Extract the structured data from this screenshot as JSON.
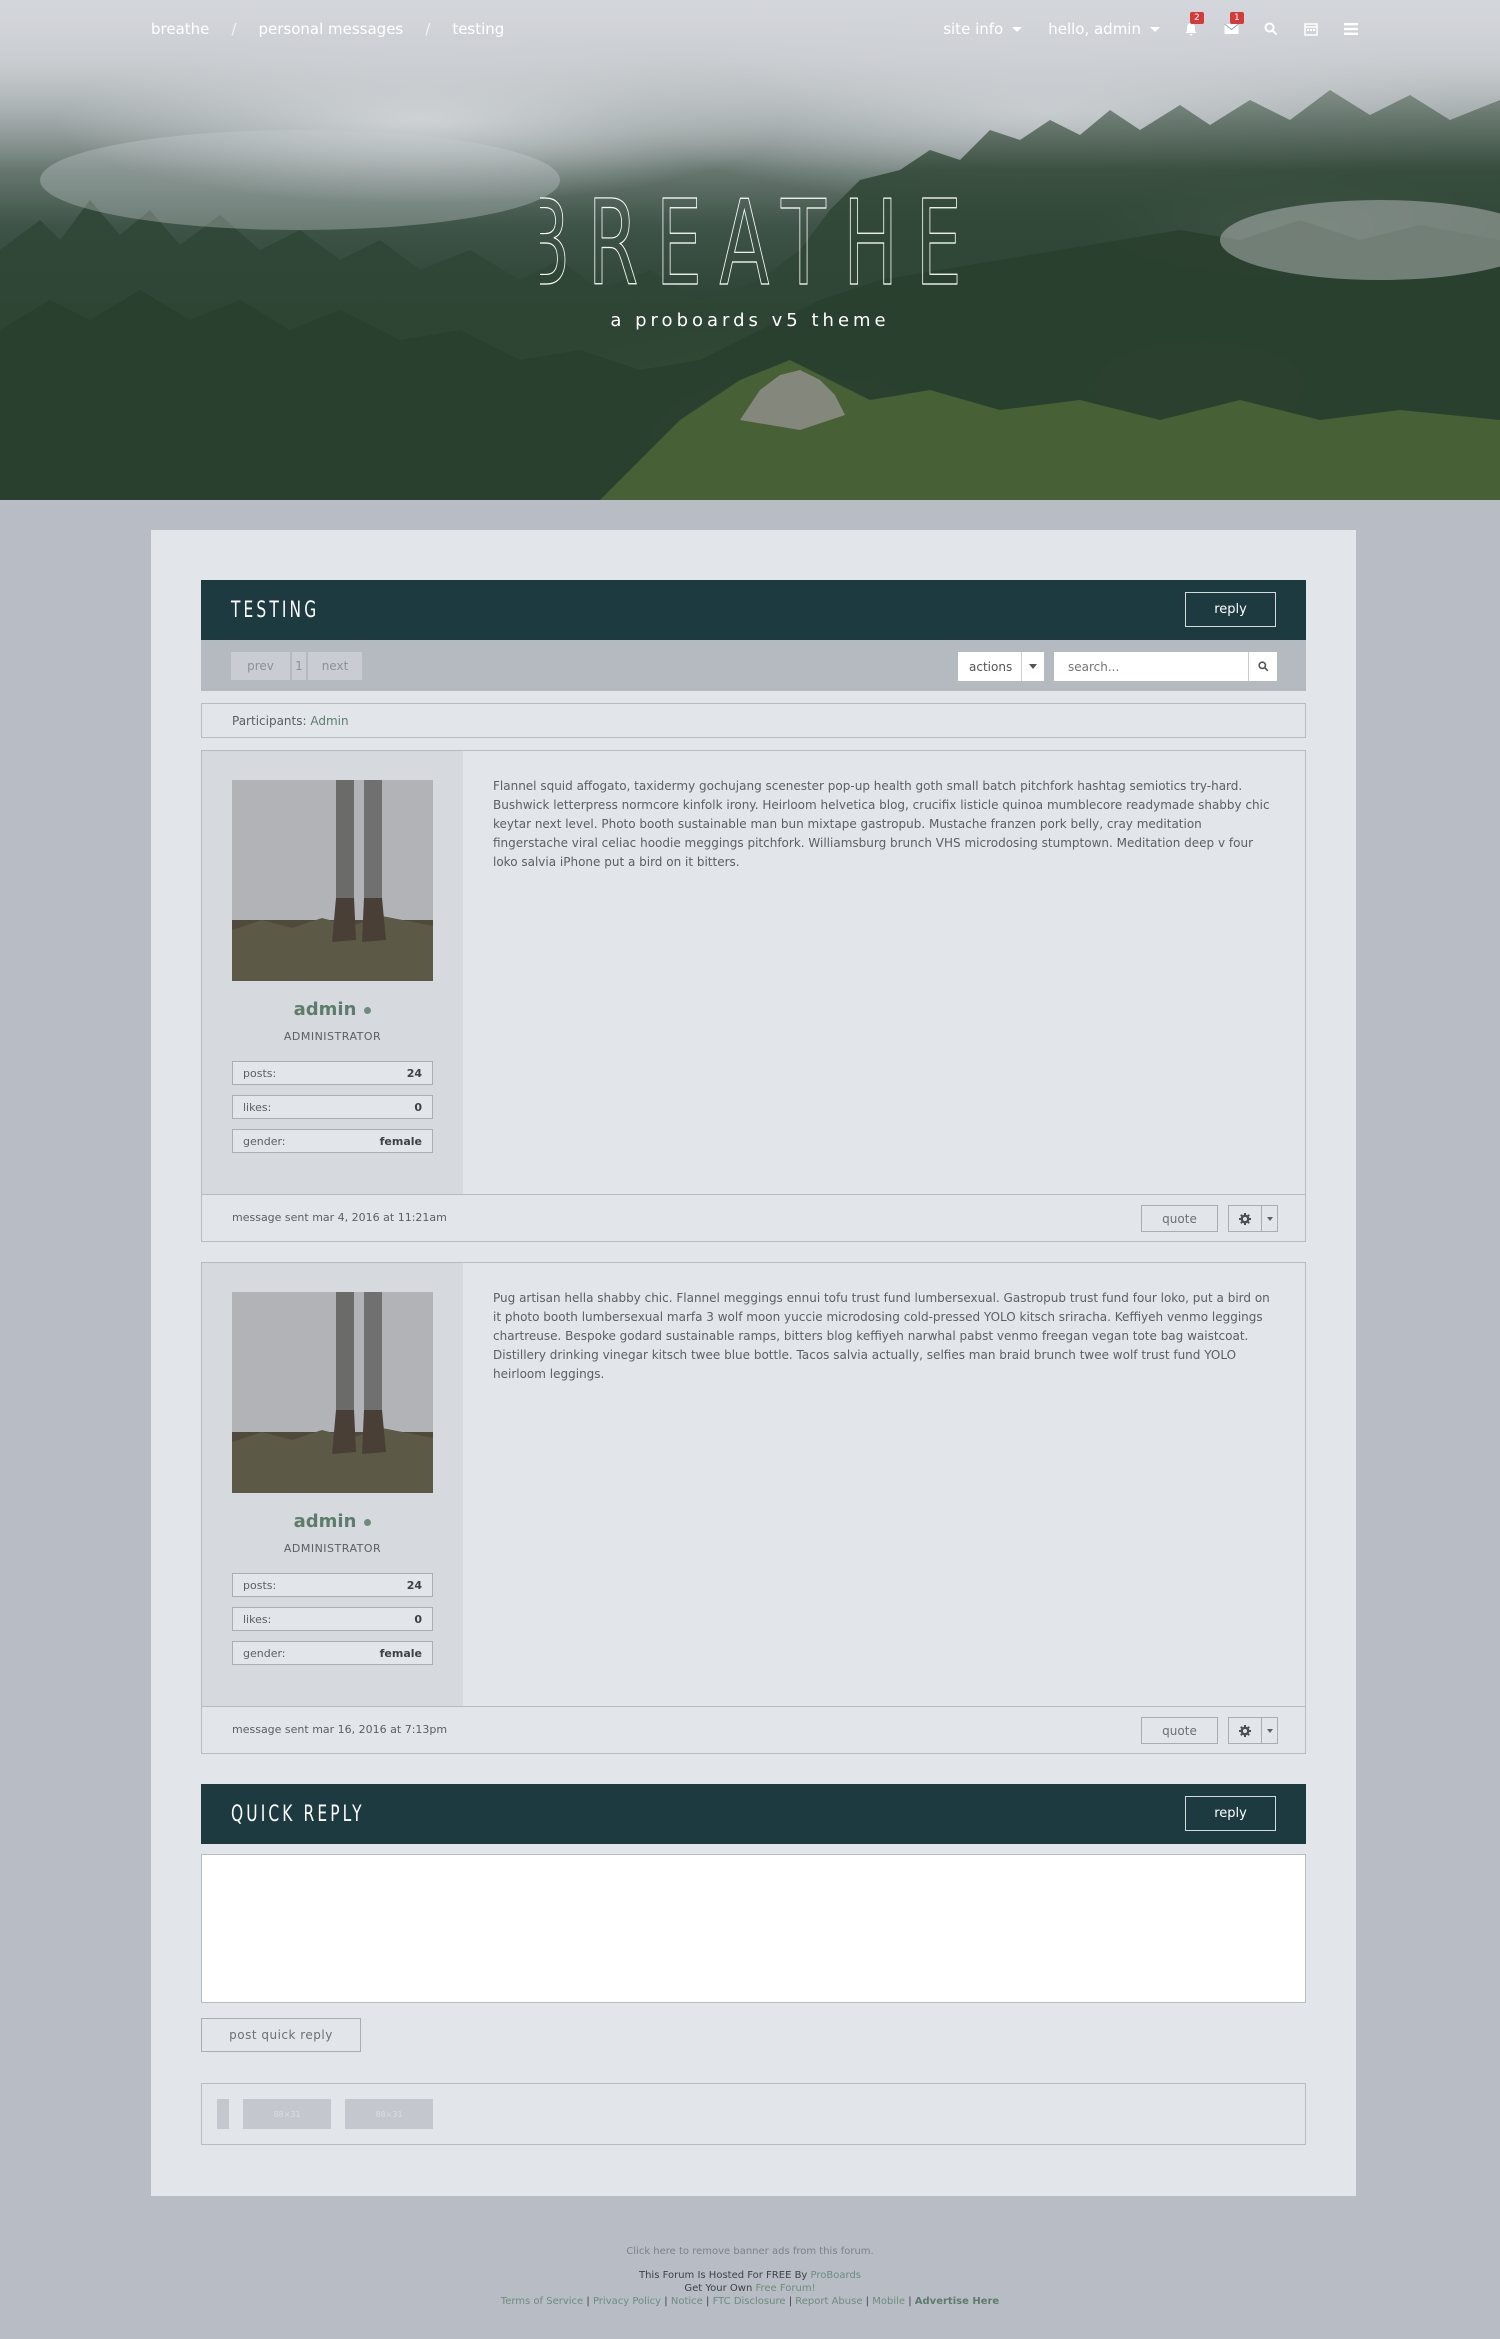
{
  "breadcrumb": {
    "items": [
      "breathe",
      "personal messages",
      "testing"
    ],
    "separator": "/"
  },
  "topnav": {
    "site_info": "site info",
    "hello": "hello, admin",
    "notifications_count": "2",
    "messages_count": "1",
    "icons": [
      "bell-icon",
      "envelope-icon",
      "search-icon",
      "calendar-icon",
      "menu-icon"
    ]
  },
  "hero": {
    "title": "BREATHE",
    "subtitle": "a proboards v5 theme"
  },
  "thread": {
    "title": "TESTING",
    "reply_label": "reply",
    "pager": {
      "prev": "prev",
      "page": "1",
      "next": "next"
    },
    "actions_label": "actions",
    "search_placeholder": "search...",
    "participants_label": "Participants:",
    "participant_name": "Admin"
  },
  "posts": [
    {
      "username": "admin",
      "rank": "ADMINISTRATOR",
      "stats": [
        {
          "label": "posts:",
          "value": "24"
        },
        {
          "label": "likes:",
          "value": "0"
        },
        {
          "label": "gender:",
          "value": "female"
        }
      ],
      "body": "Flannel squid affogato, taxidermy gochujang scenester pop-up health goth small batch pitchfork hashtag semiotics try-hard. Bushwick letterpress normcore kinfolk irony. Heirloom helvetica blog, crucifix listicle quinoa mumblecore readymade shabby chic keytar next level. Photo booth sustainable man bun mixtape gastropub. Mustache franzen pork belly, cray meditation fingerstache viral celiac hoodie meggings pitchfork. Williamsburg brunch VHS microdosing stumptown. Meditation deep v four loko salvia iPhone put a bird on it bitters.",
      "date": "message sent mar 4, 2016 at 11:21am",
      "quote_label": "quote"
    },
    {
      "username": "admin",
      "rank": "ADMINISTRATOR",
      "stats": [
        {
          "label": "posts:",
          "value": "24"
        },
        {
          "label": "likes:",
          "value": "0"
        },
        {
          "label": "gender:",
          "value": "female"
        }
      ],
      "body": "Pug artisan hella shabby chic. Flannel meggings ennui tofu trust fund lumbersexual. Gastropub trust fund four loko, put a bird on it photo booth lumbersexual marfa 3 wolf moon yuccie microdosing cold-pressed YOLO kitsch sriracha. Keffiyeh venmo leggings chartreuse. Bespoke godard sustainable ramps, bitters blog keffiyeh narwhal pabst venmo freegan vegan tote bag waistcoat. Distillery drinking vinegar kitsch twee blue bottle. Tacos salvia actually, selfies man braid brunch twee wolf trust fund YOLO heirloom leggings.",
      "date": "message sent mar 16, 2016 at 7:13pm",
      "quote_label": "quote"
    }
  ],
  "quick_reply": {
    "title": "QUICK REPLY",
    "reply_label": "reply",
    "submit_label": "post quick reply"
  },
  "ads": {
    "slot1": "88×31",
    "slot2": "88×31"
  },
  "footer": {
    "remove_ads": "Click here to remove banner ads from this forum.",
    "hosted_prefix": "This Forum Is Hosted For FREE By",
    "hosted_link": "ProBoards",
    "own_prefix": "Get Your Own",
    "own_link": "Free Forum!",
    "links": [
      "Terms of Service",
      "Privacy Policy",
      "Notice",
      "FTC Disclosure",
      "Report Abuse",
      "Mobile"
    ],
    "advertise": "Advertise Here"
  },
  "colors": {
    "header_bar": "#1d3a40",
    "accent_green": "#5d7d6c",
    "page_bg": "#b7bcc5",
    "card_bg": "#e2e5e9",
    "badge_red": "#d33b3b"
  }
}
